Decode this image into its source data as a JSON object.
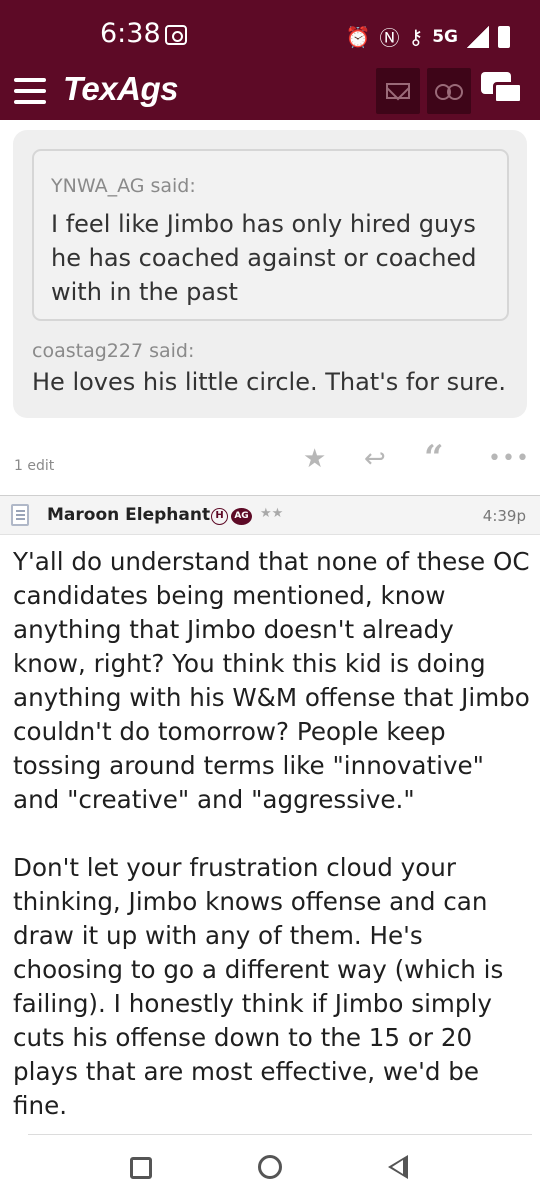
{
  "status_bar": {
    "time": "6:38",
    "network": "5G"
  },
  "header": {
    "logo": "TexAgs",
    "icons": [
      "menu-icon",
      "mail-icon",
      "binoculars-icon",
      "chat-icon"
    ],
    "brand_color": "#5d0a26"
  },
  "quote": {
    "inner_author": "YNWA_AG said:",
    "inner_text": "I feel like Jimbo has only hired guys he has coached against or coached with in the past",
    "outer_author": "coastag227 said:",
    "outer_text": "He loves his little circle. That's for sure."
  },
  "actions": {
    "edit_count": "1 edit",
    "icons": [
      "star-icon",
      "reply-icon",
      "quote-icon",
      "more-icon"
    ]
  },
  "post": {
    "author": "Maroon Elephant",
    "badge_h": "H",
    "badge_ag": "AG",
    "stars": "★★",
    "time": "4:39p",
    "paragraph1": "Y'all do understand that none of these OC candidates being mentioned, know anything that Jimbo doesn't already know, right? You think this kid is doing anything with his W&M offense that Jimbo couldn't do tomorrow? People keep tossing around terms like \"innovative\" and \"creative\" and \"aggressive.\"",
    "paragraph2": "Don't let your frustration cloud your thinking, Jimbo knows offense and can draw it up with any of them. He's choosing to go a different way (which is failing). I honestly think if Jimbo simply cuts his offense down to the 15 or 20 plays that are most effective, we'd be fine."
  },
  "navbar": {
    "icons": [
      "recents-icon",
      "home-icon",
      "back-icon"
    ]
  }
}
